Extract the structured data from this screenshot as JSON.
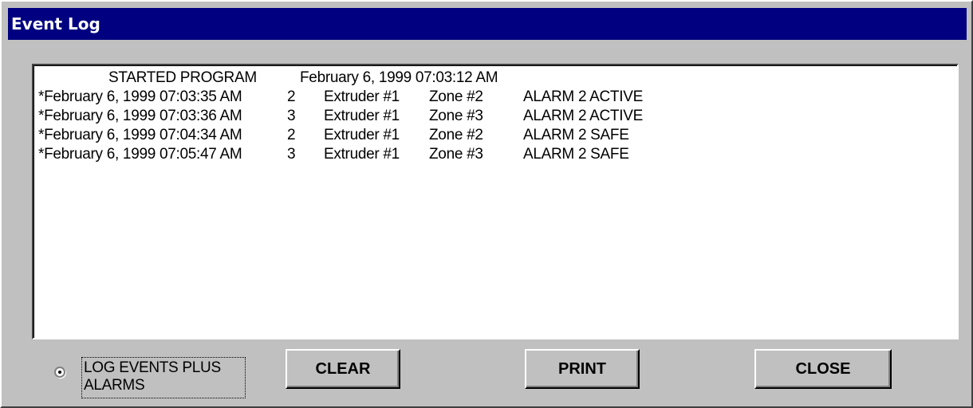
{
  "window": {
    "title": "Event Log"
  },
  "log": {
    "header": {
      "label": "STARTED PROGRAM",
      "datetime": "February 6, 1999 07:03:12 AM"
    },
    "entries": [
      {
        "datetime": "*February 6, 1999 07:03:35 AM",
        "num": "2",
        "extruder": "Extruder #1",
        "zone": "Zone #2",
        "status": "ALARM 2 ACTIVE"
      },
      {
        "datetime": "*February 6, 1999 07:03:36 AM",
        "num": "3",
        "extruder": "Extruder #1",
        "zone": "Zone #3",
        "status": "ALARM 2 ACTIVE"
      },
      {
        "datetime": "*February 6, 1999 07:04:34 AM",
        "num": "2",
        "extruder": "Extruder #1",
        "zone": "Zone #2",
        "status": "ALARM 2 SAFE"
      },
      {
        "datetime": "*February 6, 1999 07:05:47 AM",
        "num": "3",
        "extruder": "Extruder #1",
        "zone": "Zone #3",
        "status": "ALARM 2 SAFE"
      }
    ]
  },
  "option": {
    "label_line1": "LOG EVENTS PLUS",
    "label_line2": "ALARMS",
    "selected": true
  },
  "buttons": {
    "clear": "CLEAR",
    "print": "PRINT",
    "close": "CLOSE"
  },
  "colors": {
    "titlebar": "#000080",
    "face": "#c0c0c0",
    "list_bg": "#ffffff"
  }
}
